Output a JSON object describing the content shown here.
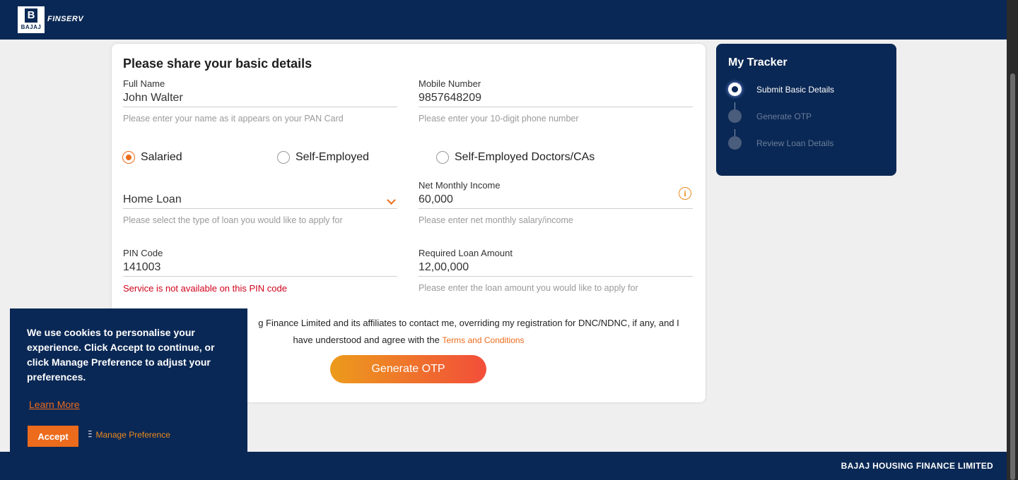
{
  "header": {
    "logo_mark": "B",
    "logo_small": "BAJAJ",
    "logo_text": "FINSERV"
  },
  "form": {
    "title": "Please share your basic details",
    "full_name": {
      "label": "Full Name",
      "value": "John Walter",
      "hint": "Please enter your name as it appears on your PAN Card"
    },
    "mobile": {
      "label": "Mobile Number",
      "value": "9857648209",
      "hint": "Please enter your 10-digit phone number"
    },
    "employment": {
      "options": [
        "Salaried",
        "Self-Employed",
        "Self-Employed Doctors/CAs"
      ],
      "selected": "Salaried"
    },
    "loan_type": {
      "value": "Home Loan",
      "hint": "Please select the type of loan you would like to apply for"
    },
    "income": {
      "label": "Net Monthly Income",
      "value": "60,000",
      "hint": "Please enter net monthly salary/income",
      "info_icon": "i"
    },
    "pin": {
      "label": "PIN Code",
      "value": "141003",
      "error": "Service is not available on this PIN code"
    },
    "loan_amount": {
      "label": "Required Loan Amount",
      "value": "12,00,000",
      "hint": "Please enter the loan amount you would like to apply for"
    },
    "consent_line1": "g Finance Limited and its affiliates to contact me, overriding my registration for DNC/NDNC, if any, and I",
    "consent_line2": "have understood and agree with the",
    "terms_link": "Terms and Conditions",
    "otp_button": "Generate OTP"
  },
  "tracker": {
    "title": "My Tracker",
    "steps": [
      {
        "label": "Submit Basic Details",
        "state": "active"
      },
      {
        "label": "Generate OTP",
        "state": "pending"
      },
      {
        "label": "Review Loan Details",
        "state": "pending"
      }
    ]
  },
  "cookie": {
    "text": "We use cookies to personalise your experience. Click Accept to continue, or click Manage Preference to adjust your preferences.",
    "learn_more": "Learn More",
    "accept": "Accept",
    "manage": "Manage Preference",
    "manage_icon": "sliders-icon"
  },
  "footer": {
    "text": "BAJAJ HOUSING FINANCE LIMITED"
  },
  "colors": {
    "navy": "#0a2855",
    "accent": "#ec6b1c",
    "error": "#d0021b"
  }
}
